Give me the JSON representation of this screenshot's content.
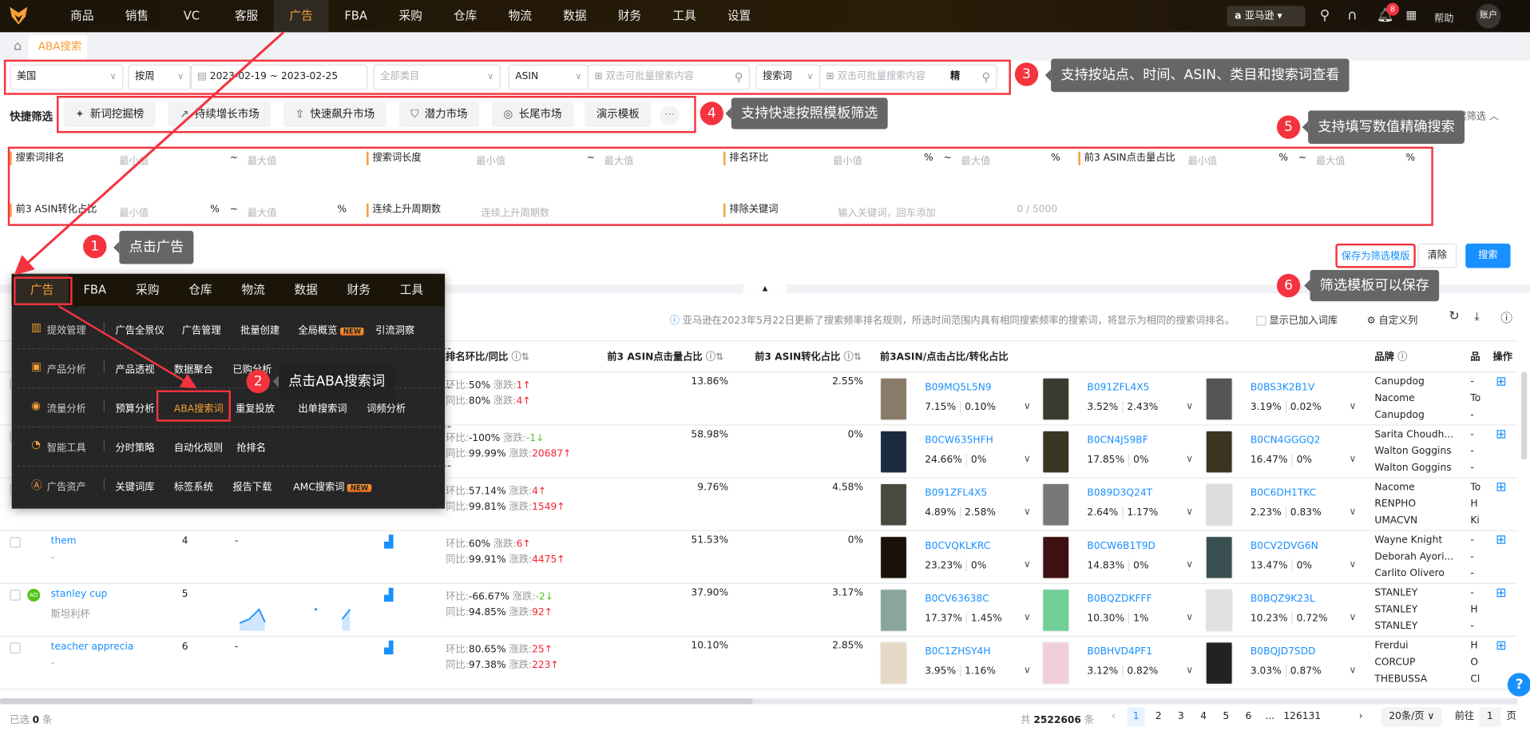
{
  "topnav": {
    "items": [
      "商品",
      "销售",
      "VC",
      "客服",
      "广告",
      "FBA",
      "采购",
      "仓库",
      "物流",
      "数据",
      "财务",
      "工具",
      "设置"
    ],
    "active_index": 4,
    "marketplace": "亚马逊",
    "notification_count": "8",
    "help": "帮助",
    "account": "账户"
  },
  "tabs": {
    "active": "ABA搜索词"
  },
  "filters": {
    "site": "美国",
    "period": "按周",
    "date_range": "2023-02-19 ~ 2023-02-25",
    "category_placeholder": "全部类目",
    "asin_type": "ASIN",
    "asin_placeholder": "双击可批量搜索内容",
    "term_type": "搜索词",
    "term_placeholder": "双击可批量搜索内容",
    "exact": "精"
  },
  "quick": {
    "label": "快捷筛选",
    "items": [
      "新词挖掘榜",
      "持续增长市场",
      "快速飙升市场",
      "潜力市场",
      "长尾市场",
      "演示模板"
    ],
    "collapse": "收起筛选"
  },
  "ranges": {
    "min": "最小值",
    "max": "最大值",
    "tilde": "~",
    "pct": "%",
    "search_rank": "搜索词排名",
    "term_length": "搜索词长度",
    "rank_change": "排名环比",
    "top3_click": "前3 ASIN点击量占比",
    "top3_conv": "前3 ASIN转化占比",
    "rising_weeks": "连续上升周期数",
    "rising_placeholder": "连续上升周期数",
    "exclude": "排除关键词",
    "exclude_placeholder": "输入关键词，回车添加",
    "exclude_count": "0 / 5000"
  },
  "actions": {
    "save_template": "保存为筛选模版",
    "clear": "清除",
    "search": "搜索"
  },
  "annotations": {
    "n1": "1",
    "n2": "2",
    "n3": "3",
    "n4": "4",
    "n5": "5",
    "n6": "6",
    "t1": "点击广告",
    "t2": "点击ABA搜索词",
    "t3": "支持按站点、时间、ASIN、类目和搜索词查看",
    "t4": "支持快速按照模板筛选",
    "t5": "支持填写数值精确搜索",
    "t6": "筛选模板可以保存"
  },
  "toolbar": {
    "info": "亚马逊在2023年5月22日更新了搜索频率排名规则，所选时间范围内具有相同搜索频率的搜索词，将显示为相同的搜索词排名。",
    "show_added": "显示已加入词库",
    "custom_columns": "自定义列"
  },
  "table": {
    "headers": {
      "partial": "内",
      "rank_change": "排名环比/同比",
      "top3_click": "前3 ASIN点击量占比",
      "top3_conv": "前3 ASIN转化占比",
      "top3_asins": "前3ASIN/点击占比/转化占比",
      "brand": "品牌",
      "category": "品",
      "action": "操作"
    },
    "labels": {
      "mom": "环比:",
      "yoy": "同比:",
      "delta": "涨跌:"
    },
    "rows": [
      {
        "keyword": "",
        "translation": "",
        "rank": "",
        "mom": "50%",
        "mom_delta": "1",
        "mom_dir": "up",
        "yoy": "80%",
        "yoy_delta": "4",
        "yoy_dir": "up",
        "click": "13.86%",
        "conv": "2.55%",
        "asins": [
          {
            "asin": "B09MQ5L5N9",
            "click": "7.15%",
            "conv": "0.10%"
          },
          {
            "asin": "B091ZFL4X5",
            "click": "3.52%",
            "conv": "2.43%"
          },
          {
            "asin": "B0BS3K2B1V",
            "click": "3.19%",
            "conv": "0.02%"
          }
        ],
        "brands": [
          "Canupdog",
          "Nacome",
          "Canupdog"
        ],
        "cats": [
          "-",
          "To",
          "-"
        ]
      },
      {
        "keyword": "",
        "translation": "",
        "rank": "",
        "mom": "-100%",
        "mom_delta": "-1",
        "mom_dir": "down",
        "yoy": "99.99%",
        "yoy_delta": "20687",
        "yoy_dir": "up",
        "click": "58.98%",
        "conv": "0%",
        "asins": [
          {
            "asin": "B0CW635HFH",
            "click": "24.66%",
            "conv": "0%"
          },
          {
            "asin": "B0CN4J59BF",
            "click": "17.85%",
            "conv": "0%"
          },
          {
            "asin": "B0CN4GGGQ2",
            "click": "16.47%",
            "conv": "0%"
          }
        ],
        "brands": [
          "Sarita Choudh...",
          "Walton Goggins",
          "Walton Goggins"
        ],
        "cats": [
          "-",
          "-",
          "-"
        ]
      },
      {
        "keyword": "",
        "translation": "",
        "rank": "",
        "mom": "57.14%",
        "mom_delta": "4",
        "mom_dir": "up",
        "yoy": "99.81%",
        "yoy_delta": "1549",
        "yoy_dir": "up",
        "click": "9.76%",
        "conv": "4.58%",
        "asins": [
          {
            "asin": "B091ZFL4X5",
            "click": "4.89%",
            "conv": "2.58%"
          },
          {
            "asin": "B089D3Q24T",
            "click": "2.64%",
            "conv": "1.17%"
          },
          {
            "asin": "B0C6DH1TKC",
            "click": "2.23%",
            "conv": "0.83%"
          }
        ],
        "brands": [
          "Nacome",
          "RENPHO",
          "UMACVN"
        ],
        "cats": [
          "To",
          "H",
          "Ki"
        ]
      },
      {
        "keyword": "them",
        "translation": "-",
        "rank": "4",
        "trend": "-",
        "mom": "60%",
        "mom_delta": "6",
        "mom_dir": "up",
        "yoy": "99.91%",
        "yoy_delta": "4475",
        "yoy_dir": "up",
        "click": "51.53%",
        "conv": "0%",
        "asins": [
          {
            "asin": "B0CVQKLKRC",
            "click": "23.23%",
            "conv": "0%"
          },
          {
            "asin": "B0CW6B1T9D",
            "click": "14.83%",
            "conv": "0%"
          },
          {
            "asin": "B0CV2DVG6N",
            "click": "13.47%",
            "conv": "0%"
          }
        ],
        "brands": [
          "Wayne Knight",
          "Deborah Ayori...",
          "Carlito Olivero"
        ],
        "cats": [
          "-",
          "-",
          "-"
        ]
      },
      {
        "keyword": "stanley cup",
        "translation": "斯坦利杯",
        "ad": "AD",
        "rank": "5",
        "sparkline": true,
        "mom": "-66.67%",
        "mom_delta": "-2",
        "mom_dir": "down",
        "yoy": "94.85%",
        "yoy_delta": "92",
        "yoy_dir": "up",
        "click": "37.90%",
        "conv": "3.17%",
        "asins": [
          {
            "asin": "B0CV63638C",
            "click": "17.37%",
            "conv": "1.45%"
          },
          {
            "asin": "B0BQZDKFFF",
            "click": "10.30%",
            "conv": "1%"
          },
          {
            "asin": "B0BQZ9K23L",
            "click": "10.23%",
            "conv": "0.72%"
          }
        ],
        "brands": [
          "STANLEY",
          "STANLEY",
          "STANLEY"
        ],
        "cats": [
          "-",
          "H",
          "-"
        ]
      },
      {
        "keyword": "teacher appreciat",
        "translation": "-",
        "rank": "6",
        "trend": "-",
        "mom": "80.65%",
        "mom_delta": "25",
        "mom_dir": "up",
        "yoy": "97.38%",
        "yoy_delta": "223",
        "yoy_dir": "up",
        "click": "10.10%",
        "conv": "2.85%",
        "asins": [
          {
            "asin": "B0C1ZHSY4H",
            "click": "3.95%",
            "conv": "1.16%"
          },
          {
            "asin": "B0BHVD4PF1",
            "click": "3.12%",
            "conv": "0.82%"
          },
          {
            "asin": "B0BQJD7SDD",
            "click": "3.03%",
            "conv": "0.87%"
          }
        ],
        "brands": [
          "Frerdui",
          "CORCUP",
          "THEBUSSA"
        ],
        "cats": [
          "H",
          "O",
          "Cl"
        ]
      }
    ]
  },
  "footer": {
    "selected_prefix": "已选",
    "selected_count": "0",
    "unit": "条",
    "total_prefix": "共",
    "total": "2522606",
    "pages": [
      "1",
      "2",
      "3",
      "4",
      "5",
      "6"
    ],
    "ellipsis": "...",
    "last_page": "126131",
    "page_size": "20条/页",
    "goto": "前往",
    "goto_value": "1",
    "page_unit": "页"
  },
  "popup": {
    "nav": [
      "广告",
      "FBA",
      "采购",
      "仓库",
      "物流",
      "数据",
      "财务",
      "工具"
    ],
    "groups": [
      {
        "name": "提效管理",
        "items": [
          "广告全景仪",
          "广告管理",
          "批量创建",
          "全局概览",
          "引流洞察"
        ],
        "new": [
          3
        ]
      },
      {
        "name": "产品分析",
        "items": [
          "产品透视",
          "数据聚合",
          "已购分析"
        ],
        "new": []
      },
      {
        "name": "流量分析",
        "items": [
          "预算分析",
          "ABA搜索词",
          "重复投放",
          "出单搜索词",
          "词频分析"
        ],
        "new": []
      },
      {
        "name": "智能工具",
        "items": [
          "分时策略",
          "自动化规则",
          "抢排名"
        ],
        "new": []
      },
      {
        "name": "广告资产",
        "items": [
          "关键词库",
          "标签系统",
          "报告下载",
          "AMC搜索词"
        ],
        "new": [
          3
        ]
      }
    ],
    "new_badge": "NEW"
  },
  "colors": {
    "accent": "#f7a035",
    "link": "#1890ff",
    "primary": "#1890ff",
    "annotation": "#f5333f",
    "up": "#f5222d",
    "down": "#52c41a"
  }
}
